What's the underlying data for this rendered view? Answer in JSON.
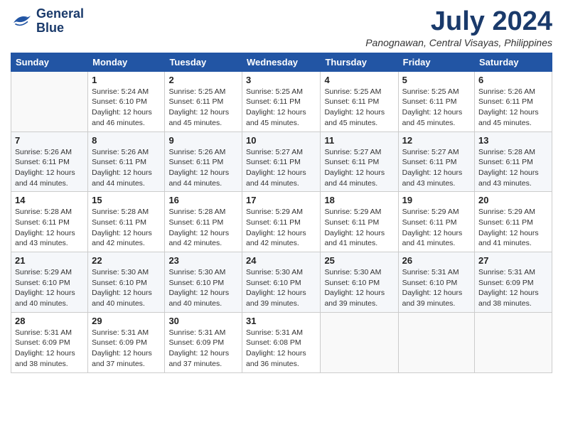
{
  "header": {
    "logo_line1": "General",
    "logo_line2": "Blue",
    "month": "July 2024",
    "location": "Panognawan, Central Visayas, Philippines"
  },
  "weekdays": [
    "Sunday",
    "Monday",
    "Tuesday",
    "Wednesday",
    "Thursday",
    "Friday",
    "Saturday"
  ],
  "weeks": [
    [
      {
        "day": "",
        "sunrise": "",
        "sunset": "",
        "daylight": ""
      },
      {
        "day": "1",
        "sunrise": "Sunrise: 5:24 AM",
        "sunset": "Sunset: 6:10 PM",
        "daylight": "Daylight: 12 hours and 46 minutes."
      },
      {
        "day": "2",
        "sunrise": "Sunrise: 5:25 AM",
        "sunset": "Sunset: 6:11 PM",
        "daylight": "Daylight: 12 hours and 45 minutes."
      },
      {
        "day": "3",
        "sunrise": "Sunrise: 5:25 AM",
        "sunset": "Sunset: 6:11 PM",
        "daylight": "Daylight: 12 hours and 45 minutes."
      },
      {
        "day": "4",
        "sunrise": "Sunrise: 5:25 AM",
        "sunset": "Sunset: 6:11 PM",
        "daylight": "Daylight: 12 hours and 45 minutes."
      },
      {
        "day": "5",
        "sunrise": "Sunrise: 5:25 AM",
        "sunset": "Sunset: 6:11 PM",
        "daylight": "Daylight: 12 hours and 45 minutes."
      },
      {
        "day": "6",
        "sunrise": "Sunrise: 5:26 AM",
        "sunset": "Sunset: 6:11 PM",
        "daylight": "Daylight: 12 hours and 45 minutes."
      }
    ],
    [
      {
        "day": "7",
        "sunrise": "Sunrise: 5:26 AM",
        "sunset": "Sunset: 6:11 PM",
        "daylight": "Daylight: 12 hours and 44 minutes."
      },
      {
        "day": "8",
        "sunrise": "Sunrise: 5:26 AM",
        "sunset": "Sunset: 6:11 PM",
        "daylight": "Daylight: 12 hours and 44 minutes."
      },
      {
        "day": "9",
        "sunrise": "Sunrise: 5:26 AM",
        "sunset": "Sunset: 6:11 PM",
        "daylight": "Daylight: 12 hours and 44 minutes."
      },
      {
        "day": "10",
        "sunrise": "Sunrise: 5:27 AM",
        "sunset": "Sunset: 6:11 PM",
        "daylight": "Daylight: 12 hours and 44 minutes."
      },
      {
        "day": "11",
        "sunrise": "Sunrise: 5:27 AM",
        "sunset": "Sunset: 6:11 PM",
        "daylight": "Daylight: 12 hours and 44 minutes."
      },
      {
        "day": "12",
        "sunrise": "Sunrise: 5:27 AM",
        "sunset": "Sunset: 6:11 PM",
        "daylight": "Daylight: 12 hours and 43 minutes."
      },
      {
        "day": "13",
        "sunrise": "Sunrise: 5:28 AM",
        "sunset": "Sunset: 6:11 PM",
        "daylight": "Daylight: 12 hours and 43 minutes."
      }
    ],
    [
      {
        "day": "14",
        "sunrise": "Sunrise: 5:28 AM",
        "sunset": "Sunset: 6:11 PM",
        "daylight": "Daylight: 12 hours and 43 minutes."
      },
      {
        "day": "15",
        "sunrise": "Sunrise: 5:28 AM",
        "sunset": "Sunset: 6:11 PM",
        "daylight": "Daylight: 12 hours and 42 minutes."
      },
      {
        "day": "16",
        "sunrise": "Sunrise: 5:28 AM",
        "sunset": "Sunset: 6:11 PM",
        "daylight": "Daylight: 12 hours and 42 minutes."
      },
      {
        "day": "17",
        "sunrise": "Sunrise: 5:29 AM",
        "sunset": "Sunset: 6:11 PM",
        "daylight": "Daylight: 12 hours and 42 minutes."
      },
      {
        "day": "18",
        "sunrise": "Sunrise: 5:29 AM",
        "sunset": "Sunset: 6:11 PM",
        "daylight": "Daylight: 12 hours and 41 minutes."
      },
      {
        "day": "19",
        "sunrise": "Sunrise: 5:29 AM",
        "sunset": "Sunset: 6:11 PM",
        "daylight": "Daylight: 12 hours and 41 minutes."
      },
      {
        "day": "20",
        "sunrise": "Sunrise: 5:29 AM",
        "sunset": "Sunset: 6:11 PM",
        "daylight": "Daylight: 12 hours and 41 minutes."
      }
    ],
    [
      {
        "day": "21",
        "sunrise": "Sunrise: 5:29 AM",
        "sunset": "Sunset: 6:10 PM",
        "daylight": "Daylight: 12 hours and 40 minutes."
      },
      {
        "day": "22",
        "sunrise": "Sunrise: 5:30 AM",
        "sunset": "Sunset: 6:10 PM",
        "daylight": "Daylight: 12 hours and 40 minutes."
      },
      {
        "day": "23",
        "sunrise": "Sunrise: 5:30 AM",
        "sunset": "Sunset: 6:10 PM",
        "daylight": "Daylight: 12 hours and 40 minutes."
      },
      {
        "day": "24",
        "sunrise": "Sunrise: 5:30 AM",
        "sunset": "Sunset: 6:10 PM",
        "daylight": "Daylight: 12 hours and 39 minutes."
      },
      {
        "day": "25",
        "sunrise": "Sunrise: 5:30 AM",
        "sunset": "Sunset: 6:10 PM",
        "daylight": "Daylight: 12 hours and 39 minutes."
      },
      {
        "day": "26",
        "sunrise": "Sunrise: 5:31 AM",
        "sunset": "Sunset: 6:10 PM",
        "daylight": "Daylight: 12 hours and 39 minutes."
      },
      {
        "day": "27",
        "sunrise": "Sunrise: 5:31 AM",
        "sunset": "Sunset: 6:09 PM",
        "daylight": "Daylight: 12 hours and 38 minutes."
      }
    ],
    [
      {
        "day": "28",
        "sunrise": "Sunrise: 5:31 AM",
        "sunset": "Sunset: 6:09 PM",
        "daylight": "Daylight: 12 hours and 38 minutes."
      },
      {
        "day": "29",
        "sunrise": "Sunrise: 5:31 AM",
        "sunset": "Sunset: 6:09 PM",
        "daylight": "Daylight: 12 hours and 37 minutes."
      },
      {
        "day": "30",
        "sunrise": "Sunrise: 5:31 AM",
        "sunset": "Sunset: 6:09 PM",
        "daylight": "Daylight: 12 hours and 37 minutes."
      },
      {
        "day": "31",
        "sunrise": "Sunrise: 5:31 AM",
        "sunset": "Sunset: 6:08 PM",
        "daylight": "Daylight: 12 hours and 36 minutes."
      },
      {
        "day": "",
        "sunrise": "",
        "sunset": "",
        "daylight": ""
      },
      {
        "day": "",
        "sunrise": "",
        "sunset": "",
        "daylight": ""
      },
      {
        "day": "",
        "sunrise": "",
        "sunset": "",
        "daylight": ""
      }
    ]
  ]
}
